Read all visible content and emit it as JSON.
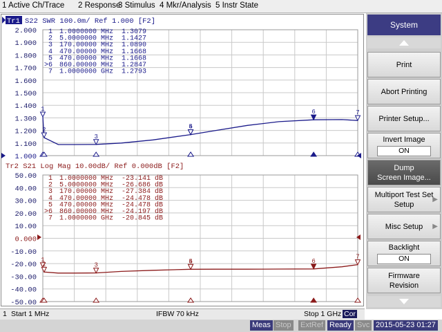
{
  "menubar": {
    "items": [
      "1 Active Ch/Trace",
      "2 Response",
      "3 Stimulus",
      "4 Mkr/Analysis",
      "5 Instr State"
    ]
  },
  "trace1": {
    "header_id": "Tr1",
    "header_text": "S22  SWR 100.0m/ Ref 1.000 [F2]",
    "color": "#1a1a8a",
    "markers": [
      {
        "num": "1",
        "freq": "1.0000000",
        "unit": "MHz",
        "value": "1.3079"
      },
      {
        "num": "2",
        "freq": "5.0000000",
        "unit": "MHz",
        "value": "1.1427"
      },
      {
        "num": "3",
        "freq": "170.00000",
        "unit": "MHz",
        "value": "1.0890"
      },
      {
        "num": "4",
        "freq": "470.00000",
        "unit": "MHz",
        "value": "1.1668"
      },
      {
        "num": "5",
        "freq": "470.00000",
        "unit": "MHz",
        "value": "1.1668"
      },
      {
        "num": ">6",
        "freq": "860.00000",
        "unit": "MHz",
        "value": "1.2847"
      },
      {
        "num": "7",
        "freq": "1.0000000",
        "unit": "GHz",
        "value": "1.2793"
      }
    ],
    "y_ticks": [
      "2.000",
      "1.900",
      "1.800",
      "1.700",
      "1.600",
      "1.500",
      "1.400",
      "1.300",
      "1.200",
      "1.100",
      "1.000"
    ],
    "ref_label": "1.000"
  },
  "trace2": {
    "header_text": "Tr2  S21  Log Mag 10.00dB/ Ref 0.000dB [F2]",
    "color": "#8b1a1a",
    "markers": [
      {
        "num": "1",
        "freq": "1.0000000",
        "unit": "MHz",
        "value": "-23.141 dB"
      },
      {
        "num": "2",
        "freq": "5.0000000",
        "unit": "MHz",
        "value": "-26.686 dB"
      },
      {
        "num": "3",
        "freq": "170.00000",
        "unit": "MHz",
        "value": "-27.384 dB"
      },
      {
        "num": "4",
        "freq": "470.00000",
        "unit": "MHz",
        "value": "-24.478 dB"
      },
      {
        "num": "5",
        "freq": "470.00000",
        "unit": "MHz",
        "value": "-24.478 dB"
      },
      {
        "num": ">6",
        "freq": "860.00000",
        "unit": "MHz",
        "value": "-24.197 dB"
      },
      {
        "num": "7",
        "freq": "1.0000000",
        "unit": "GHz",
        "value": "-20.845 dB"
      }
    ],
    "y_ticks": [
      "50.00",
      "40.00",
      "30.00",
      "20.00",
      "10.00",
      "0.000",
      "-10.00",
      "-20.00",
      "-30.00",
      "-40.00",
      "-50.00"
    ],
    "ref_label": "0.000"
  },
  "chart_data": [
    {
      "type": "line",
      "title": "S22 SWR 100.0m/ Ref 1.000 [F2]",
      "ylim": [
        1.0,
        2.0
      ],
      "x_unit": "MHz",
      "series": [
        {
          "name": "S22",
          "x": [
            1,
            5,
            50,
            100,
            170,
            250,
            350,
            470,
            550,
            650,
            750,
            860,
            950,
            1000
          ],
          "values": [
            1.3079,
            1.1427,
            1.088,
            1.088,
            1.089,
            1.1,
            1.125,
            1.1668,
            1.2,
            1.24,
            1.27,
            1.2847,
            1.286,
            1.2793
          ]
        }
      ],
      "markers": [
        {
          "label": "1",
          "x": 1,
          "y": 1.3079
        },
        {
          "label": "2",
          "x": 5,
          "y": 1.1427
        },
        {
          "label": "3",
          "x": 170,
          "y": 1.089
        },
        {
          "label": "4",
          "x": 470,
          "y": 1.1668
        },
        {
          "label": "5",
          "x": 470,
          "y": 1.1668
        },
        {
          "label": "6",
          "x": 860,
          "y": 1.2847
        },
        {
          "label": "7",
          "x": 1000,
          "y": 1.2793
        }
      ]
    },
    {
      "type": "line",
      "title": "S21 Log Mag 10.00dB/ Ref 0.000dB [F2]",
      "ylim": [
        -50,
        50
      ],
      "x_unit": "MHz",
      "series": [
        {
          "name": "S21",
          "x": [
            1,
            5,
            50,
            100,
            170,
            250,
            350,
            470,
            550,
            650,
            750,
            860,
            950,
            1000
          ],
          "values": [
            -23.141,
            -26.686,
            -27.5,
            -27.5,
            -27.384,
            -26.2,
            -25.3,
            -24.478,
            -24.4,
            -24.4,
            -24.3,
            -24.197,
            -22.5,
            -20.845
          ]
        }
      ],
      "markers": [
        {
          "label": "1",
          "x": 1,
          "y": -23.141
        },
        {
          "label": "2",
          "x": 5,
          "y": -26.686
        },
        {
          "label": "3",
          "x": 170,
          "y": -27.384
        },
        {
          "label": "4",
          "x": 470,
          "y": -24.478
        },
        {
          "label": "5",
          "x": 470,
          "y": -24.478
        },
        {
          "label": "6",
          "x": 860,
          "y": -24.197
        },
        {
          "label": "7",
          "x": 1000,
          "y": -20.845
        }
      ]
    }
  ],
  "softkeys": {
    "title": "System",
    "print": "Print",
    "abort_printing": "Abort Printing",
    "printer_setup": "Printer Setup...",
    "invert_image": "Invert Image",
    "invert_image_value": "ON",
    "dump_line1": "Dump",
    "dump_line2": "Screen Image...",
    "multiport_line1": "Multiport Test Set",
    "multiport_line2": "Setup",
    "misc_setup": "Misc Setup",
    "backlight": "Backlight",
    "backlight_value": "ON",
    "firmware_line1": "Firmware",
    "firmware_line2": "Revision"
  },
  "status": {
    "channel": "1",
    "start": "Start 1 MHz",
    "ifbw": "IFBW 70 kHz",
    "stop": "Stop 1 GHz",
    "cor": "Cor"
  },
  "bottom": {
    "meas": "Meas",
    "stop": "Stop",
    "extref": "ExtRef",
    "ready": "Ready",
    "svc": "Svc",
    "datetime": "2015-05-23 01:27"
  },
  "colors": {
    "softkey_title_bg": "#3c3c83",
    "trace1": "#1a1a8a",
    "trace2": "#8b1a1a",
    "meas_bg": "#3a3a7a",
    "grid": "#c8c8c8"
  }
}
